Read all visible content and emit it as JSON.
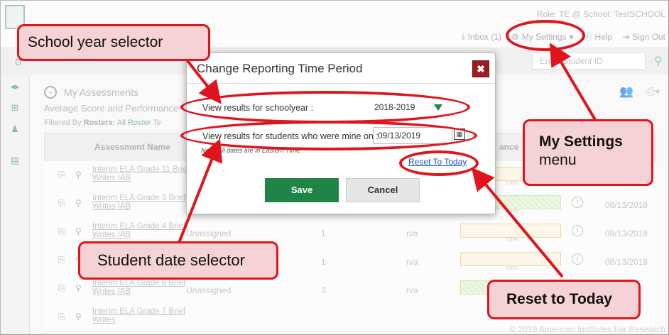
{
  "header": {
    "role_text": "Role: TE @ School: TestSCHOOL",
    "inbox_label": "Inbox (1)",
    "settings_label": "My Settings",
    "help_label": "Help",
    "signout_label": "Sign Out"
  },
  "navbar": {
    "letter": "D",
    "search_placeholder": "Enter Student ID"
  },
  "main": {
    "title": "My Assessments",
    "subtitle": "Average Score and Performance",
    "filter_prefix": "Filtered By",
    "filter_rosters_label": "Rosters:",
    "filter_rosters_value": "All Roster",
    "filter_more": "Te",
    "table": {
      "col_assessment": "Assessment Name",
      "col_performance": "ance"
    },
    "rows": [
      {
        "name": "Interim ELA Grade 11 Brief Writes IAB",
        "status": "",
        "students": "",
        "score": "",
        "pct": "100%",
        "date": "",
        "bar": "orange"
      },
      {
        "name": "Interim ELA Grade 3 Brief Writes IAB",
        "status": "",
        "students": "",
        "score": "",
        "pct": "100%",
        "date": "08/13/2018",
        "bar": "green"
      },
      {
        "name": "Interim ELA Grade 4 Brief Writes IAB",
        "status": "Unassigned",
        "students": "1",
        "score": "n/a",
        "pct": "100%",
        "date": "08/13/2018",
        "bar": "orange"
      },
      {
        "name": "Interim ELA Grade 5 Brief Writes IAB",
        "status": "Unassigned",
        "students": "1",
        "score": "n/a",
        "pct": "100%",
        "date": "08/13/2018",
        "bar": "orange"
      },
      {
        "name": "Interim ELA Grade 6 Brief Writes IAB",
        "status": "Unassigned",
        "students": "3",
        "score": "n/a",
        "pct": "",
        "date": "",
        "bar": "green"
      },
      {
        "name": "Interim ELA Grade 7 Brief Writes",
        "status": "",
        "students": "",
        "score": "",
        "pct": "",
        "date": "",
        "bar": "none"
      }
    ]
  },
  "footer": "© 2019 American Institutes For Research",
  "modal": {
    "title": "Change Reporting Time Period",
    "schoolyear_label": "View results for schoolyear :",
    "schoolyear_value": "2018-2019",
    "date_label": "View results for students who were mine on :",
    "date_value": "09/13/2019",
    "note": "Note: All dates are in Eastern Time.",
    "reset_label": "Reset To Today",
    "save_label": "Save",
    "cancel_label": "Cancel"
  },
  "annotations": {
    "school_year_selector": "School year selector",
    "my_settings_line1": "My Settings",
    "my_settings_line2": "menu",
    "student_date_selector": "Student date selector",
    "reset_to_today": "Reset to Today"
  },
  "colors": {
    "annotation_red": "#e0141c",
    "annotation_fill": "#f5d2d5",
    "save_green": "#1f8445",
    "close_red": "#9b1c22"
  }
}
